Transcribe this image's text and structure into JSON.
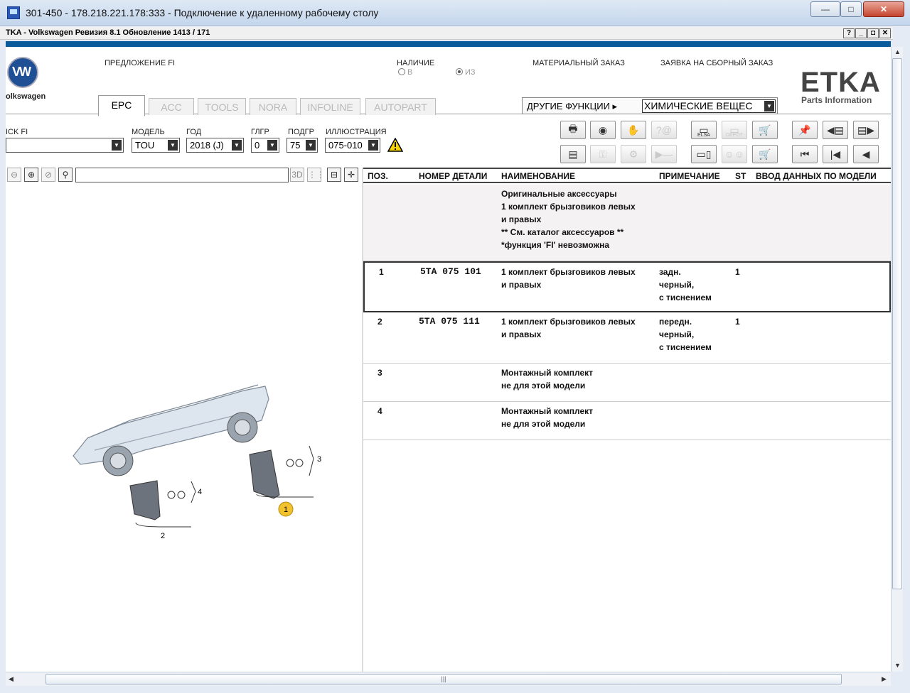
{
  "rdp": {
    "title": "301-450 - 178.218.221.178:333 - Подключение к удаленному рабочему столу",
    "min": "—",
    "max": "□",
    "close": "✕"
  },
  "app": {
    "title": "TKA - Volkswagen Ревизия 8.1 Обновление 1413 / 171",
    "btn_help": "?",
    "btn_min": "_",
    "btn_restore": "◘",
    "btn_close": "✕"
  },
  "brand": {
    "vw_text": "olkswagen",
    "etka": "ETKA",
    "etka_sub": "Parts Information"
  },
  "top": {
    "offer_fi": "ПРЕДЛОЖЕНИЕ FI",
    "availability": "НАЛИЧИЕ",
    "radio_b": "В",
    "radio_iz": "ИЗ",
    "material_order": "МАТЕРИАЛЬНЫЙ ЗАКАЗ",
    "assembly_order": "ЗАЯВКА НА СБОРНЫЙ ЗАКАЗ"
  },
  "tabs": [
    "EPC",
    "ACC",
    "TOOLS",
    "NORA",
    "INFOLINE",
    "AUTOPART"
  ],
  "functions": {
    "label": "ДРУГИЕ ФУНКЦИИ ▸",
    "selected": "ХИМИЧЕСКИЕ ВЕЩЕС"
  },
  "filters": {
    "mark_label": "ICK FI",
    "mark_value": "",
    "model_label": "МОДЕЛЬ",
    "model_value": "TOU",
    "year_label": "ГОД",
    "year_value": "2018 (J)",
    "mgroup_label": "ГЛГР",
    "mgroup_value": "0",
    "sgroup_label": "ПОДГР",
    "sgroup_value": "75",
    "illus_label": "ИЛЛЮСТРАЦИЯ",
    "illus_value": "075-010"
  },
  "toolbar_icons": {
    "elsa": "ELSA",
    "depot": "DEPOT"
  },
  "table": {
    "headers": {
      "pos": "ПОЗ.",
      "part": "НОМЕР ДЕТАЛИ",
      "name": "НАИМЕНОВАНИЕ",
      "note": "ПРИМЕЧАНИЕ",
      "st": "ST",
      "model": "ВВОД ДАННЫХ ПО МОДЕЛИ"
    },
    "intro": "Оригинальные аксессуары\n1 комплект брызговиков левых\nи правых\n** См. каталог аксессуаров  **\n*функция 'FI' невозможна",
    "rows": [
      {
        "pos": "1",
        "part": "5TA  075  101",
        "name": "1 комплект брызговиков левых\nи правых",
        "note": "задн.\nчерный,\nс тиснением",
        "st": "1"
      },
      {
        "pos": "2",
        "part": "5TA  075  111",
        "name": "1 комплект брызговиков левых\nи правых",
        "note": "передн.\nчерный,\nс тиснением",
        "st": "1"
      },
      {
        "pos": "3",
        "part": "",
        "name": "Монтажный комплект\nне для этой модели",
        "note": "",
        "st": ""
      },
      {
        "pos": "4",
        "part": "",
        "name": "Монтажный комплект\nне для этой модели",
        "note": "",
        "st": ""
      }
    ]
  },
  "illustration": {
    "callout_1": "1",
    "callout_2": "2",
    "callout_3": "3",
    "callout_4": "4"
  },
  "scroll": {
    "grip": "|||"
  },
  "colors": {
    "band": "#0a5b9c",
    "callout": "#f2c12e"
  }
}
